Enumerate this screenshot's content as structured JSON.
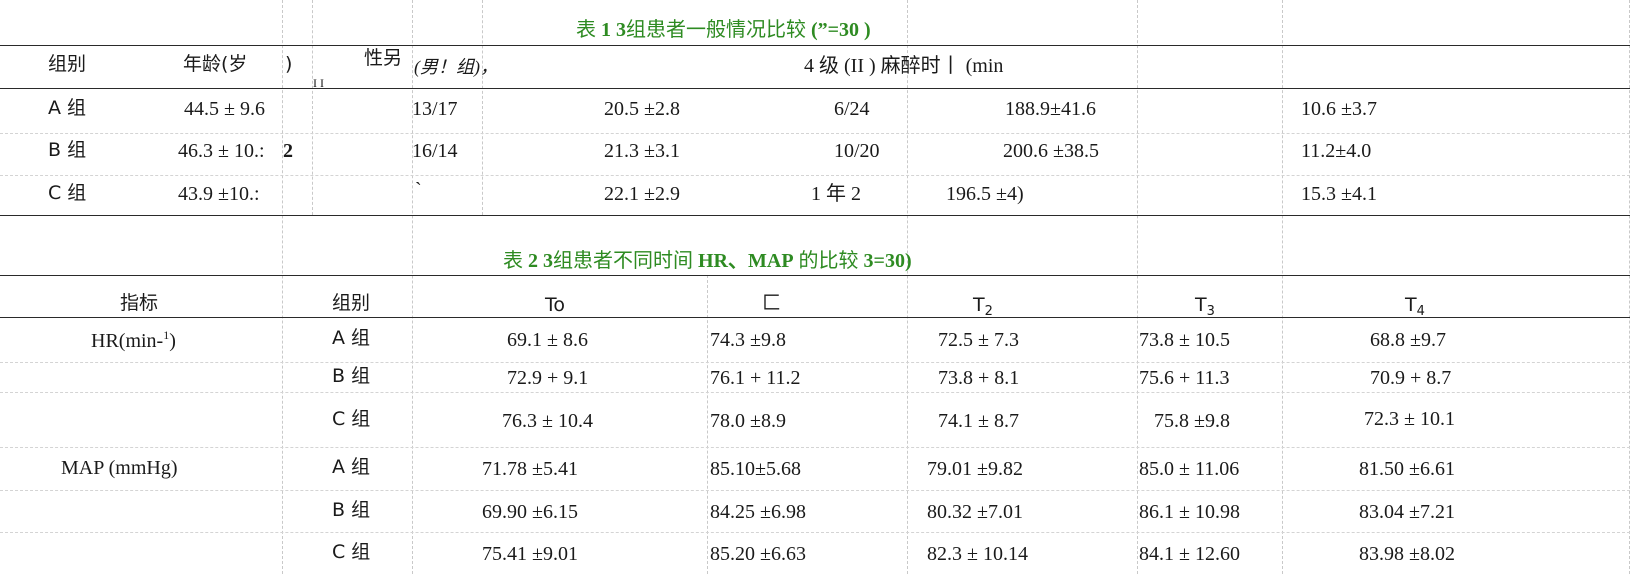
{
  "table1": {
    "caption_prefix": "表",
    "caption_num": "1 3",
    "caption_mid": "组患者一般情况比较",
    "caption_suffix": "(”=30 )",
    "headers": {
      "group": "组别",
      "age": "年龄(岁",
      "age_close": ")",
      "sex": "性另",
      "sex_mark": "I I",
      "sex_sub": "(男！组)，",
      "asa": "4 级 (II ) 麻醉时丨 (min"
    },
    "rows": [
      {
        "group": "A 组",
        "age": "44.5 ± 9.6",
        "age_tail": "",
        "sex": "13/17",
        "bmi": "20.5 ±2.8",
        "asa": "6/24",
        "time": "188.9±41.6",
        "last": "10.6 ±3.7"
      },
      {
        "group": "B 组",
        "age": "46.3 ± 10.:",
        "age_tail": "2",
        "sex": "16/14",
        "bmi": "21.3 ±3.1",
        "asa": "10/20",
        "time": "200.6 ±38.5",
        "last": "11.2±4.0"
      },
      {
        "group": "C 组",
        "age": "43.9 ±10.:",
        "age_tail": "",
        "sex": "`",
        "bmi": "22.1 ±2.9",
        "asa": "1 年 2",
        "time": "196.5 ±4)",
        "last": "15.3 ±4.1"
      }
    ]
  },
  "table2": {
    "caption_prefix": "表",
    "caption_num": "2 3",
    "caption_mid": "组患者不同时间",
    "caption_bold": "HR、MAP",
    "caption_mid2": "的比较",
    "caption_suffix": "3=30)",
    "headers": {
      "indicator": "指标",
      "group": "组别",
      "t0": "To",
      "t1": "匚",
      "t2": "T",
      "t2_sub": "2",
      "t3": "T",
      "t3_sub": "3",
      "t4": "T",
      "t4_sub": "4"
    },
    "hr_label": "HR(min-",
    "hr_sup": "1",
    "hr_close": ")",
    "map_label": "MAP (mmHg)",
    "hr_rows": [
      {
        "group": "A 组",
        "v": [
          "69.1 ± 8.6",
          "74.3 ±9.8",
          "72.5 ± 7.3",
          "73.8 ± 10.5",
          "68.8 ±9.7"
        ]
      },
      {
        "group": "B 组",
        "v": [
          "72.9 + 9.1",
          "76.1 + 11.2",
          "73.8 + 8.1",
          "75.6 + 11.3",
          "70.9 + 8.7"
        ]
      },
      {
        "group": "C 组",
        "v": [
          "76.3 ± 10.4",
          "78.0 ±8.9",
          "74.1 ± 8.7",
          "75.8 ±9.8",
          "72.3 ±  10.1"
        ]
      }
    ],
    "map_rows": [
      {
        "group": "A 组",
        "v": [
          "71.78 ±5.41",
          "85.10±5.68",
          "79.01 ±9.82",
          "85.0 ± 11.06",
          "81.50 ±6.61"
        ]
      },
      {
        "group": "B 组",
        "v": [
          "69.90 ±6.15",
          "84.25 ±6.98",
          "80.32 ±7.01",
          "86.1 ± 10.98",
          "83.04 ±7.21"
        ]
      },
      {
        "group": "C 组",
        "v": [
          "75.41 ±9.01",
          "85.20 ±6.63",
          "82.3 ± 10.14",
          "84.1 ± 12.60",
          "83.98 ±8.02"
        ]
      }
    ]
  }
}
